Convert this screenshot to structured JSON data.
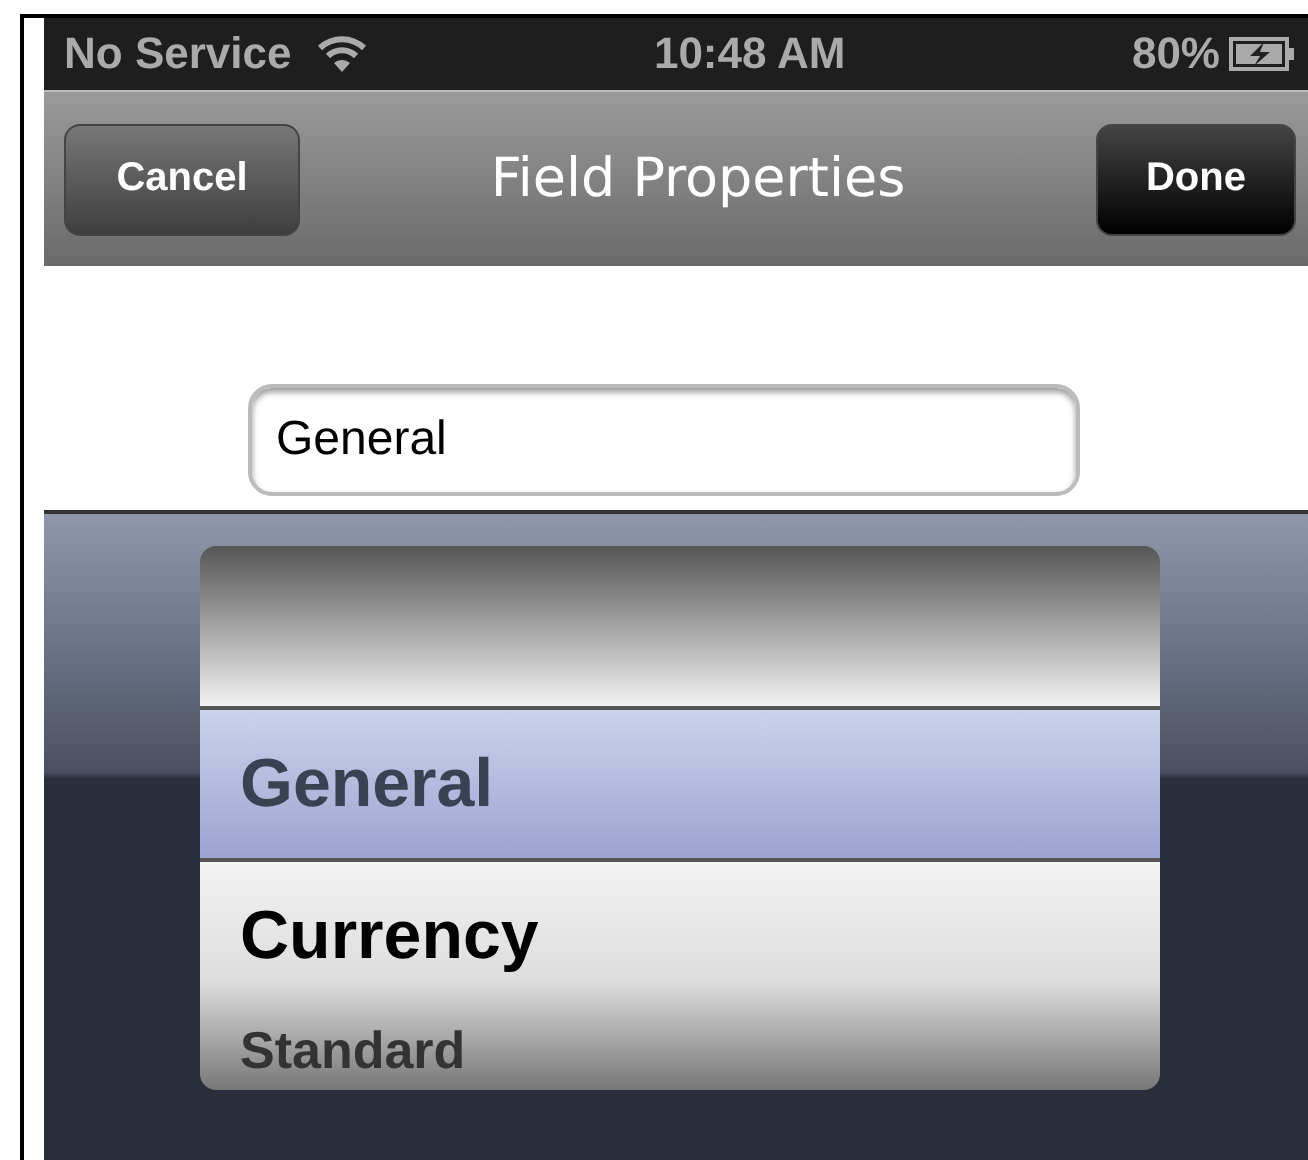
{
  "status_bar": {
    "carrier": "No Service",
    "time": "10:48 AM",
    "battery": "80%"
  },
  "nav_bar": {
    "title": "Field Properties",
    "left_button": "Cancel",
    "right_button": "Done"
  },
  "field": {
    "value": "General"
  },
  "picker": {
    "items": [
      {
        "label": "General",
        "selected": true
      },
      {
        "label": "Currency",
        "selected": false
      },
      {
        "label": "Standard",
        "selected": false
      }
    ]
  }
}
